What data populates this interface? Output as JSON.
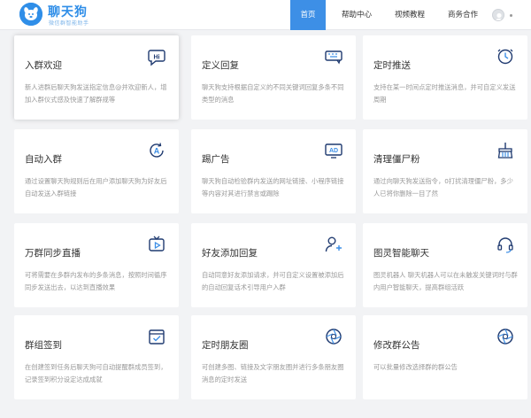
{
  "brand": {
    "name": "聊天狗",
    "tagline": "微信群智能助手",
    "color": "#2f8ee8"
  },
  "nav": {
    "items": [
      {
        "label": "首页",
        "active": true
      },
      {
        "label": "帮助中心",
        "active": false
      },
      {
        "label": "视频教程",
        "active": false
      },
      {
        "label": "商务合作",
        "active": false
      }
    ],
    "user_suffix": "·"
  },
  "features": [
    {
      "title": "入群欢迎",
      "desc": "新人进群后聊天狗发送指定信息@并欢迎新人，增加入群仪式感及快速了解群规等",
      "icon": "hi-speech-icon"
    },
    {
      "title": "定义回复",
      "desc": "聊天狗支持根据自定义的不同关键词回复多条不同类型的消息",
      "icon": "keyboard-chat-icon"
    },
    {
      "title": "定时推送",
      "desc": "支持在某一时间点定时推送消息，并可自定义发送周期",
      "icon": "clock-icon"
    },
    {
      "title": "自动入群",
      "desc": "通过设置聊天狗规则后在用户添加聊天狗为好友后自动发送入群链接",
      "icon": "auto-a-icon"
    },
    {
      "title": "踢广告",
      "desc": "聊天狗自动检验群内发送的网址链接、小程序链接等内容对其进行禁言或踢除",
      "icon": "ad-icon"
    },
    {
      "title": "清理僵尸粉",
      "desc": "通过向聊天狗发送指令，0打扰清理僵尸粉，多少人已将你删除一目了然",
      "icon": "broom-icon"
    },
    {
      "title": "万群同步直播",
      "desc": "可将需要在多群内发布的多条消息，按照时间循序同步发送出去，以达到直播效果",
      "icon": "live-icon"
    },
    {
      "title": "好友添加回复",
      "desc": "自动同意好友添加请求，并可自定义设置被添加后的自动回复话术引导用户入群",
      "icon": "add-friend-icon"
    },
    {
      "title": "图灵智能聊天",
      "desc": "图灵机器人 聊天机器人可以在未触发关键词时与群内用户智能聊天，提高群组活跃",
      "icon": "headset-icon"
    },
    {
      "title": "群组签到",
      "desc": "在创建签到任务后聊天狗可自动提醒群成员签到，记录签到积分设定达成成就",
      "icon": "checkin-icon"
    },
    {
      "title": "定时朋友圈",
      "desc": "可创建多图、链接及文字朋友圈并进行多条朋友圈消息的定时发送",
      "icon": "aperture-icon"
    },
    {
      "title": "修改群公告",
      "desc": "可以批量修改选择群的群公告",
      "icon": "aperture-icon"
    }
  ]
}
